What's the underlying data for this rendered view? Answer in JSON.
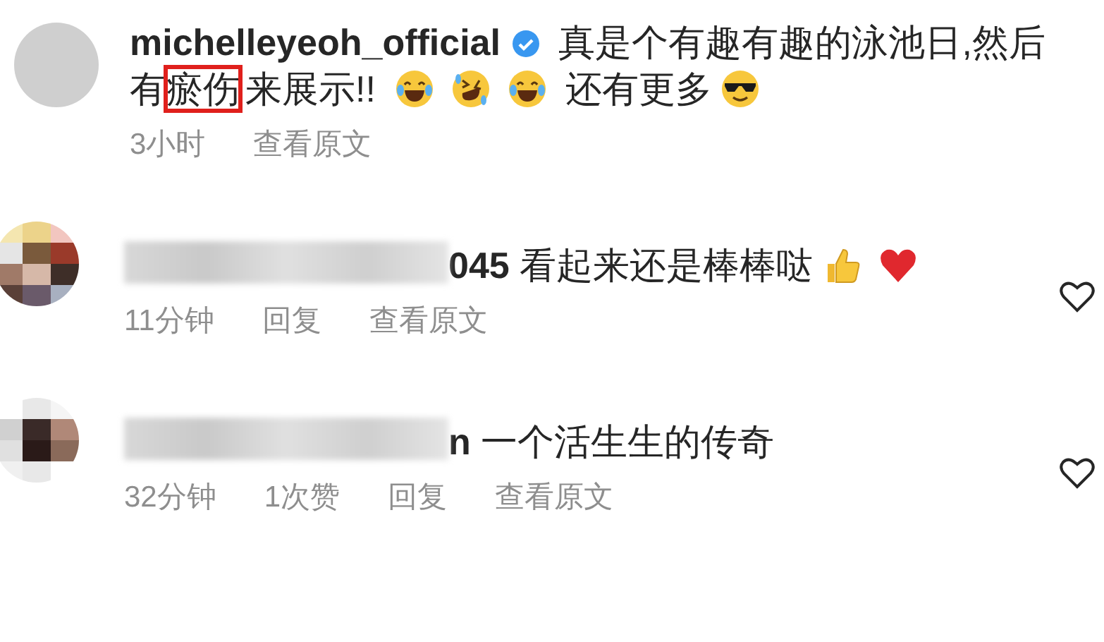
{
  "comments": [
    {
      "author": {
        "kind": "photo",
        "username": "michelleyeoh_official",
        "verified": true
      },
      "segments": [
        {
          "kind": "text",
          "text": "真是个有趣有趣的泳池日,然后有"
        },
        {
          "kind": "text",
          "text": "瘀伤",
          "highlighted": true
        },
        {
          "kind": "text",
          "text": "来展示!! "
        },
        {
          "kind": "laugh"
        },
        {
          "kind": "rofl"
        },
        {
          "kind": "laugh"
        },
        {
          "kind": "text",
          "text": " 还有更多"
        },
        {
          "kind": "cool"
        }
      ],
      "meta": [
        "3小时",
        "查看原文"
      ]
    },
    {
      "author": {
        "kind": "pixelated",
        "username_visible": "045"
      },
      "segments": [
        {
          "kind": "text",
          "text": "看起来还是棒棒哒"
        },
        {
          "kind": "thumbs"
        },
        {
          "kind": "heart"
        }
      ],
      "meta": [
        "11分钟",
        "回复",
        "查看原文"
      ],
      "like_button": true
    },
    {
      "author": {
        "kind": "pixelated",
        "username_visible": "n"
      },
      "segments": [
        {
          "kind": "text",
          "text": "一个活生生的传奇"
        }
      ],
      "meta": [
        "32分钟",
        "1次赞",
        "回复",
        "查看原文"
      ],
      "like_button": true
    }
  ]
}
